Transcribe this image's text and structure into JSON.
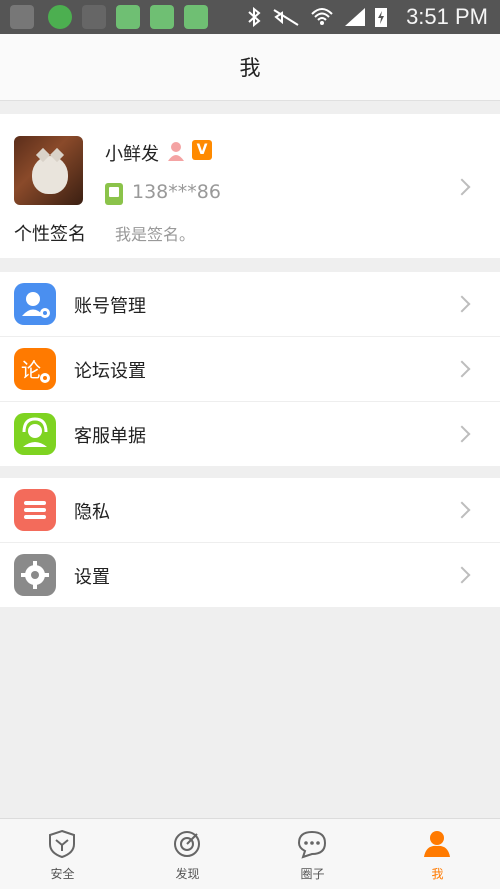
{
  "status_bar": {
    "time": "3:51 PM"
  },
  "header": {
    "title": "我"
  },
  "profile": {
    "username": "小鲜发",
    "badge": "V",
    "phone": "138***86",
    "signature_label": "个性签名",
    "signature_value": "我是签名。"
  },
  "menu_group_1": [
    {
      "label": "账号管理",
      "icon": "account-icon",
      "color": "#4a8ff0"
    },
    {
      "label": "论坛设置",
      "icon": "forum-settings-icon",
      "color": "#ff7a00"
    },
    {
      "label": "客服单据",
      "icon": "customer-service-icon",
      "color": "#7ed321"
    }
  ],
  "menu_group_2": [
    {
      "label": "隐私",
      "icon": "privacy-icon",
      "color": "#f36b5b"
    },
    {
      "label": "设置",
      "icon": "settings-gear-icon",
      "color": "#8a8a8a"
    }
  ],
  "tabbar": {
    "tabs": [
      {
        "label": "安全",
        "icon": "shield-icon"
      },
      {
        "label": "发现",
        "icon": "compass-icon"
      },
      {
        "label": "圈子",
        "icon": "chat-bubble-icon"
      },
      {
        "label": "我",
        "icon": "person-icon"
      }
    ],
    "active_color": "#ff7a00"
  }
}
